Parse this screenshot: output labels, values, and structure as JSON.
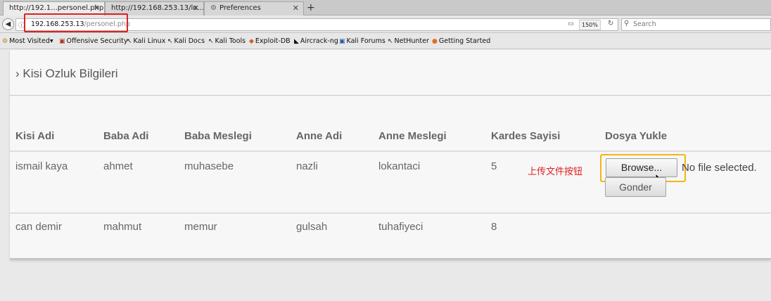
{
  "browser": {
    "tabs": [
      {
        "label": "http://192.1...personel.php",
        "active": true
      },
      {
        "label": "http://192.168.253.13/lo...",
        "active": false
      },
      {
        "label": "Preferences",
        "active": false,
        "icon": "gear-icon"
      }
    ],
    "new_tab": "+",
    "url_host": "192.168.253.13",
    "url_path": "/personel.php",
    "zoom": "150%",
    "search_placeholder": "Search",
    "bookmarks": [
      {
        "label": "Most Visited",
        "icon": "gear-icon",
        "dropdown": true
      },
      {
        "label": "Offensive Security",
        "icon": "offsec-icon"
      },
      {
        "label": "Kali Linux",
        "icon": "kali-dragon-icon"
      },
      {
        "label": "Kali Docs",
        "icon": "kali-dragon-icon"
      },
      {
        "label": "Kali Tools",
        "icon": "kali-dragon-icon"
      },
      {
        "label": "Exploit-DB",
        "icon": "exploit-db-icon"
      },
      {
        "label": "Aircrack-ng",
        "icon": "aircrack-icon"
      },
      {
        "label": "Kali Forums",
        "icon": "kali-forums-icon"
      },
      {
        "label": "NetHunter",
        "icon": "kali-dragon-icon"
      },
      {
        "label": "Getting Started",
        "icon": "firefox-icon"
      }
    ]
  },
  "page": {
    "heading": "› Kisi Ozluk Bilgileri",
    "columns": [
      "Kisi Adi",
      "Baba Adi",
      "Baba Meslegi",
      "Anne Adi",
      "Anne Meslegi",
      "Kardes Sayisi",
      "Dosya Yukle"
    ],
    "rows": [
      [
        "ismail kaya",
        "ahmet",
        "muhasebe",
        "nazli",
        "lokantaci",
        "5"
      ],
      [
        "can demir",
        "mahmut",
        "memur",
        "gulsah",
        "tuhafiyeci",
        "8"
      ]
    ],
    "upload": {
      "annotation": "上传文件按钮",
      "browse_label": "Browse...",
      "no_file_text": "No file selected.",
      "submit_label": "Gonder"
    }
  },
  "colors": {
    "annotation_red": "#e02020",
    "annotation_yellow": "#f3b512"
  }
}
